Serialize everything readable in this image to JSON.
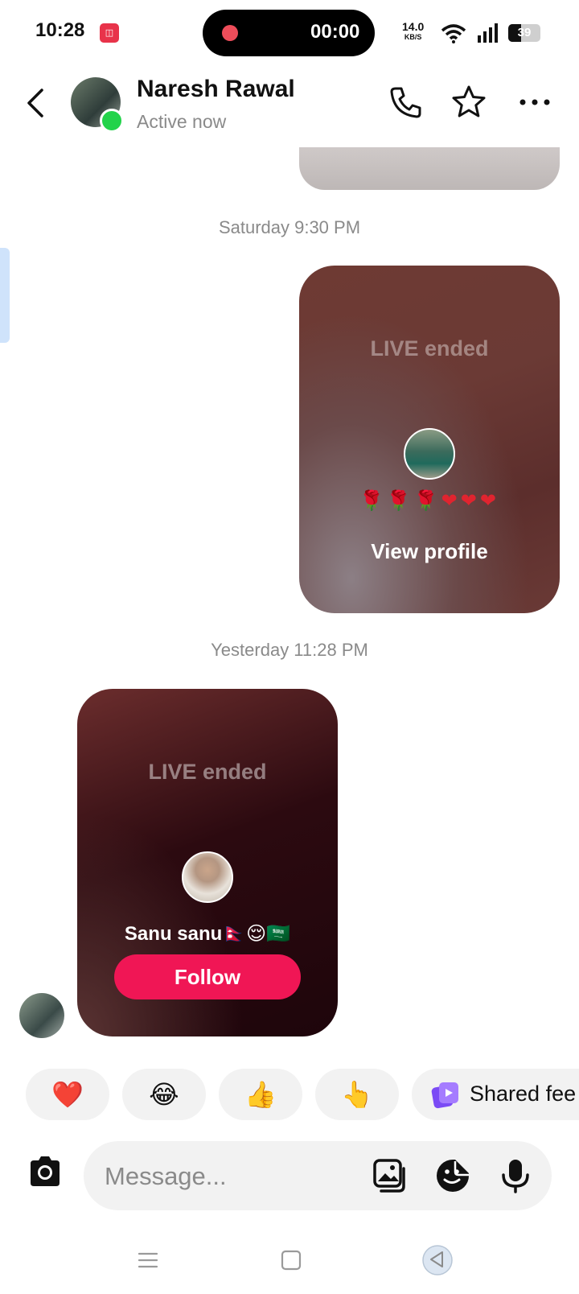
{
  "status_bar": {
    "time": "10:28",
    "recording_time": "00:00",
    "net_speed": "14.0",
    "net_unit": "KB/S",
    "battery": "39",
    "battery_level": 0.39
  },
  "header": {
    "contact_name": "Naresh Rawal",
    "status": "Active now"
  },
  "chat": {
    "timestamps": [
      "Saturday 9:30 PM",
      "Yesterday 11:28 PM"
    ],
    "cards": [
      {
        "title": "LIVE ended",
        "emoji": "🌹🌹🌹❤❤❤",
        "action": "View profile"
      },
      {
        "title": "LIVE ended",
        "name": "Sanu sanu🇳🇵😌🇸🇦",
        "action": "Follow"
      }
    ]
  },
  "quick_reactions": [
    "❤️",
    "😂",
    "👍",
    "👆"
  ],
  "shared_feed_label": "Shared fee",
  "composer": {
    "placeholder": "Message..."
  },
  "colors": {
    "accent": "#f01655",
    "online": "#22d34a",
    "chip_bg": "#f2f2f2"
  },
  "icons": [
    "back-arrow-icon",
    "phone-icon",
    "star-icon",
    "more-icon",
    "camera-icon",
    "gallery-icon",
    "sticker-icon",
    "mic-icon",
    "menu-icon",
    "home-icon",
    "back-icon",
    "shared-feed-icon"
  ]
}
